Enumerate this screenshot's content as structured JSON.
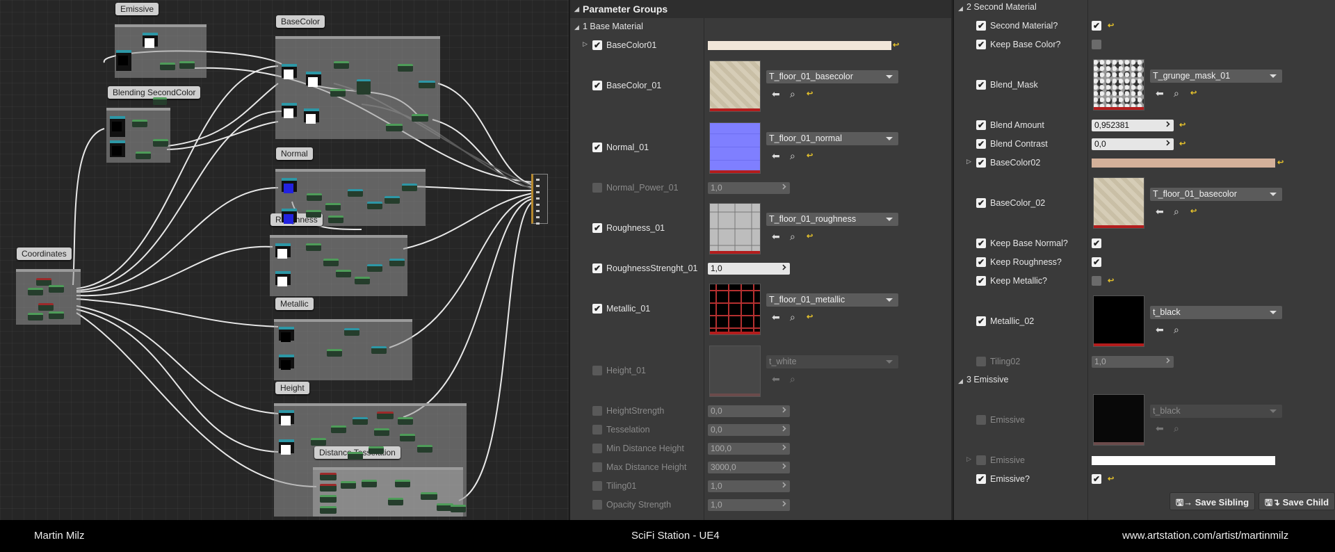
{
  "graph": {
    "comments": {
      "emissive": "Emissive",
      "basecolor": "BaseColor",
      "blending": "Blending SecondColor",
      "normal": "Normal",
      "roughness": "Roughness",
      "coordinates": "Coordinates",
      "metallic": "Metallic",
      "height": "Height",
      "distance": "Distance Tesselation"
    }
  },
  "panel1": {
    "title": "Parameter Groups",
    "section": "1 Base Material",
    "rows": {
      "basecolor01": "BaseColor01",
      "basecolor_01": "BaseColor_01",
      "normal_01": "Normal_01",
      "normal_power_01": "Normal_Power_01",
      "roughness_01": "Roughness_01",
      "roughness_strenght_01": "RoughnessStrenght_01",
      "metallic_01": "Metallic_01",
      "height_01": "Height_01",
      "height_strength": "HeightStrength",
      "tesselation": "Tesselation",
      "min_distance_height": "Min Distance Height",
      "max_distance_height": "Max Distance Height",
      "tiling01": "Tiling01",
      "opacity_strength": "Opacity Strength"
    },
    "values": {
      "normal_power_01": "1,0",
      "roughness_strenght_01": "1,0",
      "height_strength": "0,0",
      "tesselation": "0,0",
      "min_distance_height": "100,0",
      "max_distance_height": "3000,0",
      "tiling01": "1,0",
      "opacity_strength": "1,0"
    },
    "textures": {
      "basecolor_01": "T_floor_01_basecolor",
      "normal_01": "T_floor_01_normal",
      "roughness_01": "T_floor_01_roughness",
      "metallic_01": "T_floor_01_metallic",
      "height_01": "t_white"
    },
    "colors": {
      "basecolor01": "#f1e6d9"
    }
  },
  "panel2": {
    "section2": "2 Second Material",
    "section3": "3 Emissive",
    "rows": {
      "second_material": "Second Material?",
      "keep_base_color": "Keep Base Color?",
      "blend_mask": "Blend_Mask",
      "blend_amount": "Blend Amount",
      "blend_contrast": "Blend Contrast",
      "basecolor02": "BaseColor02",
      "basecolor_02": "BaseColor_02",
      "keep_base_normal": "Keep Base Normal?",
      "keep_roughness": "Keep Roughness?",
      "keep_metallic": "Keep Metallic?",
      "metallic_02": "Metallic_02",
      "tiling02": "Tiling02",
      "emissive_tex": "Emissive",
      "emissive_color": "Emissive",
      "emissive_toggle": "Emissive?"
    },
    "values": {
      "blend_amount": "0,952381",
      "blend_contrast": "0,0",
      "tiling02": "1,0"
    },
    "textures": {
      "blend_mask": "T_grunge_mask_01",
      "basecolor_02": "T_floor_01_basecolor",
      "metallic_02": "t_black",
      "emissive": "t_black"
    },
    "colors": {
      "basecolor02": "#d4b19a",
      "emissive": "#ffffff"
    },
    "buttons": {
      "save_sibling": "Save Sibling",
      "save_child": "Save Child"
    }
  },
  "footer": {
    "author": "Martin Milz",
    "project": "SciFi Station - UE4",
    "url": "www.artstation.com/artist/martinmilz"
  }
}
